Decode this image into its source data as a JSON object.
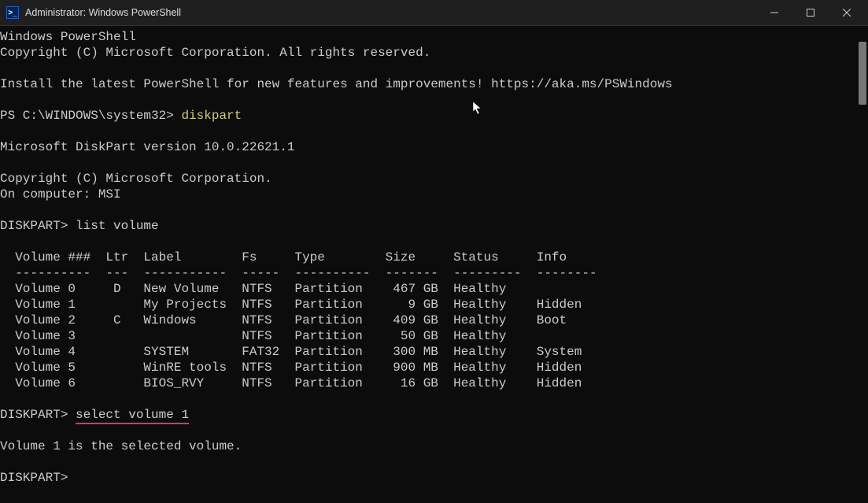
{
  "window": {
    "title": "Administrator: Windows PowerShell"
  },
  "intro": {
    "line1": "Windows PowerShell",
    "line2": "Copyright (C) Microsoft Corporation. All rights reserved.",
    "line3": "Install the latest PowerShell for new features and improvements! https://aka.ms/PSWindows"
  },
  "ps_prompt": "PS C:\\WINDOWS\\system32> ",
  "cmd_diskpart": "diskpart",
  "diskpart": {
    "version_line": "Microsoft DiskPart version 10.0.22621.1",
    "copyright": "Copyright (C) Microsoft Corporation.",
    "computer_line": "On computer: MSI",
    "prompt": "DISKPART> ",
    "cmd_list": "list volume",
    "header": "  Volume ###  Ltr  Label        Fs     Type        Size     Status     Info",
    "divider": "  ----------  ---  -----------  -----  ----------  -------  ---------  --------",
    "rows": [
      "  Volume 0     D   New Volume   NTFS   Partition    467 GB  Healthy",
      "  Volume 1         My Projects  NTFS   Partition      9 GB  Healthy    Hidden",
      "  Volume 2     C   Windows      NTFS   Partition    409 GB  Healthy    Boot",
      "  Volume 3                      NTFS   Partition     50 GB  Healthy",
      "  Volume 4         SYSTEM       FAT32  Partition    300 MB  Healthy    System",
      "  Volume 5         WinRE tools  NTFS   Partition    900 MB  Healthy    Hidden",
      "  Volume 6         BIOS_RVY     NTFS   Partition     16 GB  Healthy    Hidden"
    ],
    "cmd_select": "select volume 1",
    "select_response": "Volume 1 is the selected volume.",
    "final_prompt": "DISKPART>"
  },
  "icons": {
    "app_glyph": ">_"
  }
}
